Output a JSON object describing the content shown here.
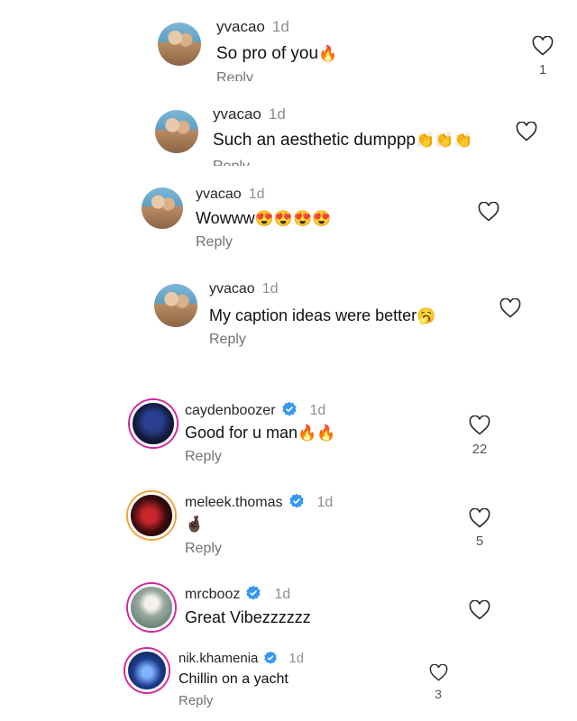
{
  "comments": [
    {
      "username": "yvacao",
      "time": "1d",
      "text": "So pro of you",
      "emoji": "🔥",
      "reply": "Reply",
      "likes": "1"
    },
    {
      "username": "yvacao",
      "time": "1d",
      "text": "Such an aesthetic dumppp",
      "emoji": "👏👏👏",
      "reply": "Reply",
      "likes": ""
    },
    {
      "username": "yvacao",
      "time": "1d",
      "text": "Wowww",
      "emoji": "😍😍😍😍",
      "reply": "Reply",
      "likes": ""
    },
    {
      "username": "yvacao",
      "time": "1d",
      "text": "My caption ideas were better",
      "emoji": "🥱",
      "reply": "Reply",
      "likes": ""
    },
    {
      "username": "caydenboozer",
      "time": "1d",
      "text": "Good for u man",
      "emoji": "🔥🔥",
      "reply": "Reply",
      "likes": "22"
    },
    {
      "username": "meleek.thomas",
      "time": "1d",
      "text": "",
      "emoji": "🤞🏿",
      "reply": "Reply",
      "likes": "5"
    },
    {
      "username": "mrcbooz",
      "time": "1d",
      "text": "Great Vibezzzzzz",
      "emoji": "",
      "reply": "",
      "likes": ""
    },
    {
      "username": "nik.khamenia",
      "time": "1d",
      "text": "Chillin on a yacht",
      "emoji": "",
      "reply": "Reply",
      "likes": "3"
    }
  ]
}
